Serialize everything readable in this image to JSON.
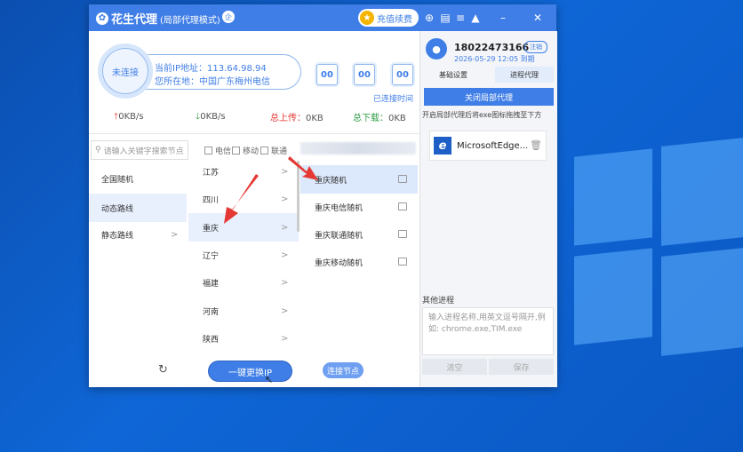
{
  "desktop": {
    "logo": "windows-logo"
  },
  "titlebar": {
    "brand": "花生代理",
    "mode": "(局部代理模式)",
    "enterprise_badge": "企",
    "recharge_label": "充值续费",
    "icons": [
      "globe-icon",
      "list-icon",
      "menu-icon",
      "bell-icon",
      "minimize-icon",
      "close-icon"
    ]
  },
  "status": {
    "connection": "未连接",
    "current_ip": "当前IP地址：113.64.98.94",
    "location": "您所在地：中国广东梅州电信",
    "timer": [
      "00",
      "00",
      "00"
    ],
    "connected_time_label": "已连接时间",
    "upload_speed": "0KB/s",
    "download_speed": "0KB/s",
    "total_upload_label": "总上传：",
    "total_upload_value": "0KB",
    "total_download_label": "总下载：",
    "total_download_value": "0KB"
  },
  "search": {
    "placeholder": "请输入关键字搜索节点"
  },
  "filters": [
    "电信",
    "移动",
    "联通"
  ],
  "categories": [
    {
      "label": "全国随机",
      "active": false
    },
    {
      "label": "动态路线",
      "active": true
    },
    {
      "label": "静态路线",
      "active": false
    }
  ],
  "provinces": [
    {
      "label": "江苏",
      "active": false
    },
    {
      "label": "四川",
      "active": false
    },
    {
      "label": "重庆",
      "active": true
    },
    {
      "label": "辽宁",
      "active": false
    },
    {
      "label": "福建",
      "active": false
    },
    {
      "label": "河南",
      "active": false
    },
    {
      "label": "陕西",
      "active": false
    }
  ],
  "nodes": [
    {
      "label": "重庆随机",
      "active": true
    },
    {
      "label": "重庆电信随机",
      "active": false
    },
    {
      "label": "重庆联通随机",
      "active": false
    },
    {
      "label": "重庆移动随机",
      "active": false
    }
  ],
  "actions": {
    "change_ip": "一键更换IP",
    "connect_node": "连接节点"
  },
  "account": {
    "phone": "18022473166",
    "logout": "注销",
    "expire": "2026-05-29 12:05 到期"
  },
  "tabs": [
    "基础设置",
    "进程代理"
  ],
  "proxy": {
    "close_button": "关闭局部代理",
    "hint": "开启局部代理后将exe图标拖拽至下方",
    "process_name": "MicrosoftEdge...",
    "other_label": "其他进程",
    "input_placeholder": "输入进程名称,用英文逗号隔开,例如: chrome.exe,TIM.exe",
    "clear": "清空",
    "save": "保存"
  },
  "colors": {
    "accent": "#3f7ee6",
    "arrow": "#e53935",
    "upload_arrow": "#e53935",
    "download_arrow": "#2e9e44",
    "total_upload": "#e53935",
    "total_download": "#2e9e44"
  }
}
